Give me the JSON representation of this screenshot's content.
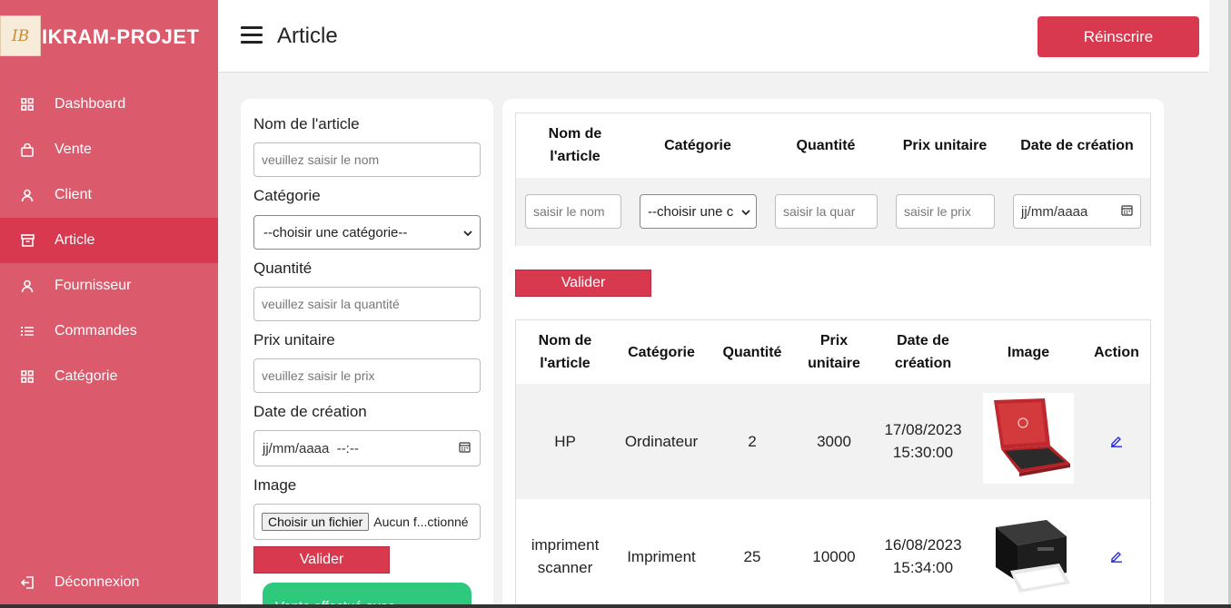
{
  "app": {
    "brand_title": "IKRAM-PROJET",
    "logo_text": "IB"
  },
  "sidebar": {
    "items": [
      {
        "label": "Dashboard",
        "icon": "grid-icon"
      },
      {
        "label": "Vente",
        "icon": "bag-icon"
      },
      {
        "label": "Client",
        "icon": "user-icon"
      },
      {
        "label": "Article",
        "icon": "archive-icon",
        "active": true
      },
      {
        "label": "Fournisseur",
        "icon": "user-icon"
      },
      {
        "label": "Commandes",
        "icon": "list-icon"
      },
      {
        "label": "Catégorie",
        "icon": "grid-icon"
      }
    ],
    "logout_label": "Déconnexion"
  },
  "header": {
    "title": "Article",
    "reinscrire_label": "Réinscrire"
  },
  "form": {
    "nom_label": "Nom de l'article",
    "nom_placeholder": "veuillez saisir le nom",
    "categorie_label": "Catégorie",
    "categorie_selected": "--choisir une catégorie--",
    "quantite_label": "Quantité",
    "quantite_placeholder": "veuillez saisir la quantité",
    "prix_label": "Prix unitaire",
    "prix_placeholder": "veuillez saisir le prix",
    "date_label": "Date de création",
    "date_value": "jj/mm/aaaa  --:--",
    "image_label": "Image",
    "file_button": "Choisir un fichier",
    "file_status": "Aucun f...ctionné",
    "valider_label": "Valider",
    "toast_text": "Vente effectué avec"
  },
  "filter": {
    "headers": {
      "nom_line1": "Nom de",
      "nom_line2": "l'article",
      "categorie": "Catégorie",
      "quantite": "Quantité",
      "prix": "Prix unitaire",
      "date": "Date de création"
    },
    "nom_placeholder": "saisir le nom",
    "categorie_selected": "--choisir une c",
    "quantite_placeholder": "saisir la quar",
    "prix_placeholder": "saisir le prix",
    "date_value": "jj/mm/aaaa",
    "valider_label": "Valider"
  },
  "table": {
    "headers": {
      "nom_line1": "Nom de",
      "nom_line2": "l'article",
      "categorie": "Catégorie",
      "quantite": "Quantité",
      "prix_line1": "Prix",
      "prix_line2": "unitaire",
      "date_line1": "Date de",
      "date_line2": "création",
      "image": "Image",
      "action": "Action"
    },
    "rows": [
      {
        "nom_line1": "HP",
        "nom_line2": "",
        "categorie": "Ordinateur",
        "quantite": "2",
        "prix": "3000",
        "date_line1": "17/08/2023",
        "date_line2": "15:30:00",
        "image": "red-laptop"
      },
      {
        "nom_line1": "impriment",
        "nom_line2": "scanner",
        "categorie": "Impriment",
        "quantite": "25",
        "prix": "10000",
        "date_line1": "16/08/2023",
        "date_line2": "15:34:00",
        "image": "black-printer"
      }
    ]
  },
  "colors": {
    "sidebar": "#db5a6c",
    "accent": "#d8394f",
    "success": "#2ec97c"
  }
}
